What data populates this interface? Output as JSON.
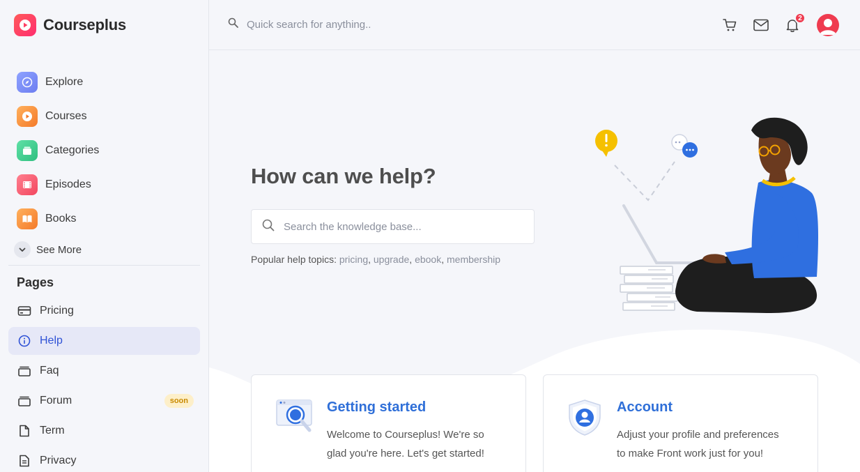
{
  "brand": {
    "name": "Courseplus"
  },
  "nav": {
    "items": [
      {
        "label": "Explore",
        "icon": "compass-icon",
        "color": "#7b8cf0"
      },
      {
        "label": "Courses",
        "icon": "play-icon",
        "color": "#f7913e"
      },
      {
        "label": "Categories",
        "icon": "categories-icon",
        "color": "#3cc98f"
      },
      {
        "label": "Episodes",
        "icon": "film-icon",
        "color": "#f5566d"
      },
      {
        "label": "Books",
        "icon": "book-icon",
        "color": "#f7913e"
      }
    ],
    "see_more": "See More"
  },
  "pages": {
    "title": "Pages",
    "items": [
      {
        "label": "Pricing",
        "icon": "credit-card-icon"
      },
      {
        "label": "Help",
        "icon": "info-icon",
        "active": true
      },
      {
        "label": "Faq",
        "icon": "stack-icon"
      },
      {
        "label": "Forum",
        "icon": "stack-icon",
        "badge": "soon"
      },
      {
        "label": "Term",
        "icon": "file-icon"
      },
      {
        "label": "Privacy",
        "icon": "document-icon"
      }
    ]
  },
  "topbar": {
    "search_placeholder": "Quick search for anything..",
    "notification_count": "2"
  },
  "hero": {
    "title": "How can we help?",
    "search_placeholder": "Search the knowledge base...",
    "popular_label": "Popular help topics:",
    "topics": [
      "pricing",
      "upgrade",
      "ebook",
      "membership"
    ]
  },
  "cards": [
    {
      "title": "Getting started",
      "text_line1": "Welcome to Courseplus! We're so",
      "text_line2": "glad you're here. Let's get started!"
    },
    {
      "title": "Account",
      "text_line1": "Adjust your profile and preferences",
      "text_line2": "to make Front work just for you!"
    }
  ],
  "colors": {
    "accent": "#2f52d6",
    "link": "#2f6fd8",
    "brand": "#ff3d62",
    "badge": "#ef3b4f"
  }
}
